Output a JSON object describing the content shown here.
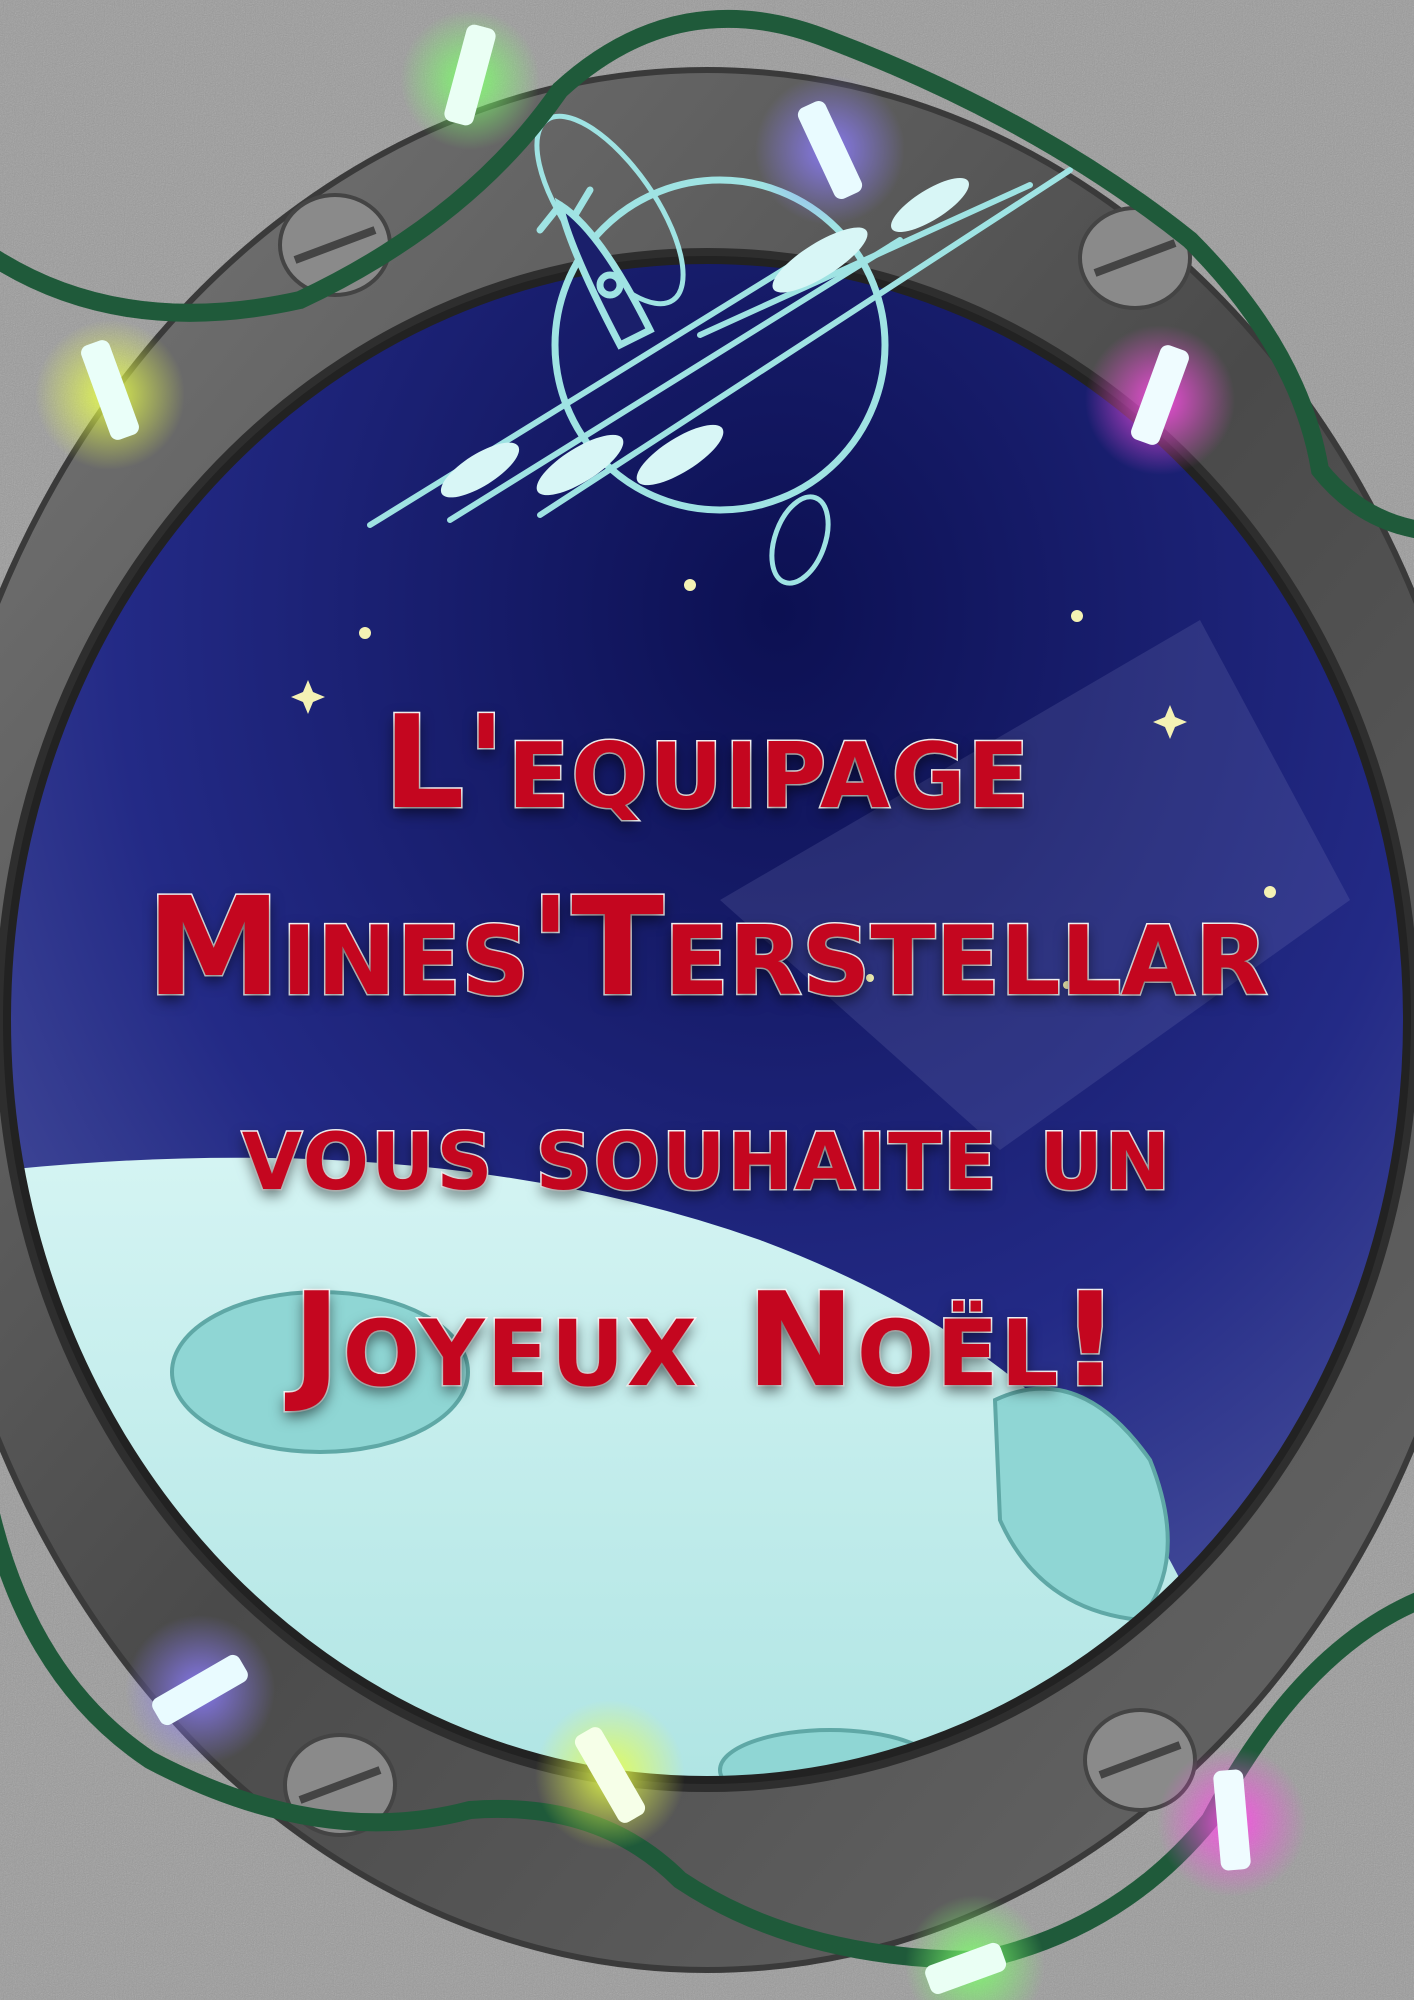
{
  "greeting": {
    "line1": "L'equipage",
    "line2": "Mines'Terstellar",
    "line3": "vous souhaite un",
    "line4": "Joyeux Noël!"
  },
  "colors": {
    "wall": "#9b9b9b",
    "frame": "#5c5c5c",
    "space_top": "#0c1052",
    "space_mid": "#232a86",
    "planet": "#bdeceb",
    "text": "#c4061f",
    "text_outline": "#ffffff",
    "logo": "#9fe3e3",
    "cable": "#1f5a3a",
    "bulb_colors": [
      "#7ddc6b",
      "#c9d84a",
      "#8c7cff",
      "#e24de0"
    ]
  },
  "icons": [
    "rocket-icon",
    "planet-icon",
    "screw-icon",
    "light-bulb-icon",
    "star-icon"
  ]
}
